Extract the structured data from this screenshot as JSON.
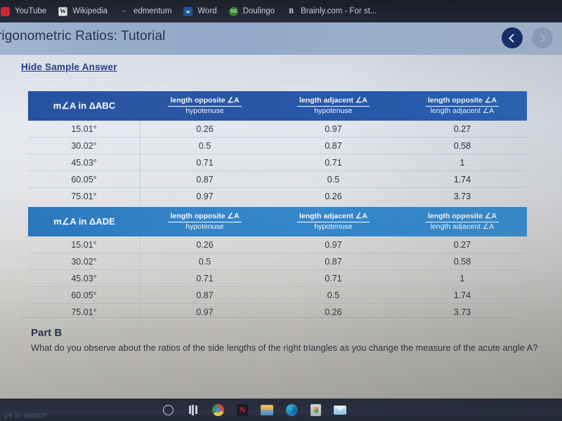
{
  "bookmarks": [
    {
      "label": "YouTube",
      "icon": "youtube-icon",
      "glyph": ""
    },
    {
      "label": "Wikipedia",
      "icon": "wikipedia-icon",
      "glyph": "W"
    },
    {
      "label": "edmentum",
      "icon": "edmentum-icon",
      "glyph": "··"
    },
    {
      "label": "Word",
      "icon": "word-icon",
      "glyph": "w"
    },
    {
      "label": "Doulingo",
      "icon": "duolingo-icon",
      "glyph": "0.0"
    },
    {
      "label": "Brainly.com - For st...",
      "icon": "brainly-icon",
      "glyph": "B"
    }
  ],
  "title_bar": {
    "title": "rigonometric Ratios: Tutorial",
    "back_label": "Back",
    "forward_label": "Forward"
  },
  "content": {
    "hide_sample_answer": "Hide Sample Answer"
  },
  "tables": [
    {
      "id": "abc",
      "angle_header": "m∠A in ΔABC",
      "columns": [
        {
          "numerator": "length opposite ∠A",
          "denominator": "hypotenuse"
        },
        {
          "numerator": "length adjacent ∠A",
          "denominator": "hypotenuse"
        },
        {
          "numerator": "length opposite ∠A",
          "denominator": "length adjacent ∠A"
        }
      ],
      "rows": [
        {
          "angle": "15.01°",
          "values": [
            "0.26",
            "0.97",
            "0.27"
          ]
        },
        {
          "angle": "30.02°",
          "values": [
            "0.5",
            "0.87",
            "0.58"
          ]
        },
        {
          "angle": "45.03°",
          "values": [
            "0.71",
            "0.71",
            "1"
          ]
        },
        {
          "angle": "60.05°",
          "values": [
            "0.87",
            "0.5",
            "1.74"
          ]
        },
        {
          "angle": "75.01°",
          "values": [
            "0.97",
            "0.26",
            "3.73"
          ]
        }
      ],
      "header_color": "#1a4a9e"
    },
    {
      "id": "ade",
      "angle_header": "m∠A in ΔADE",
      "columns": [
        {
          "numerator": "length opposite ∠A",
          "denominator": "hypotenuse"
        },
        {
          "numerator": "length adjacent ∠A",
          "denominator": "hypotenuse"
        },
        {
          "numerator": "length opposite ∠A",
          "denominator": "length adjacent ∠A"
        }
      ],
      "rows": [
        {
          "angle": "15.01°",
          "values": [
            "0.26",
            "0.97",
            "0.27"
          ]
        },
        {
          "angle": "30.02°",
          "values": [
            "0.5",
            "0.87",
            "0.58"
          ]
        },
        {
          "angle": "45.03°",
          "values": [
            "0.71",
            "0.71",
            "1"
          ]
        },
        {
          "angle": "60.05°",
          "values": [
            "0.87",
            "0.5",
            "1.74"
          ]
        },
        {
          "angle": "75.01°",
          "values": [
            "0.97",
            "0.26",
            "3.73"
          ]
        }
      ],
      "header_color": "#2f86ce"
    }
  ],
  "part_b": {
    "heading": "Part B",
    "question": "What do you observe about the ratios of the side lengths of the right triangles as you change the measure of the acute angle A?"
  },
  "taskbar": {
    "search_hint": "pe to search",
    "icons": [
      "cortana-search-icon",
      "task-view-icon",
      "chrome-icon",
      "netflix-icon",
      "file-explorer-icon",
      "edge-icon",
      "microsoft-store-icon",
      "mail-icon"
    ]
  }
}
